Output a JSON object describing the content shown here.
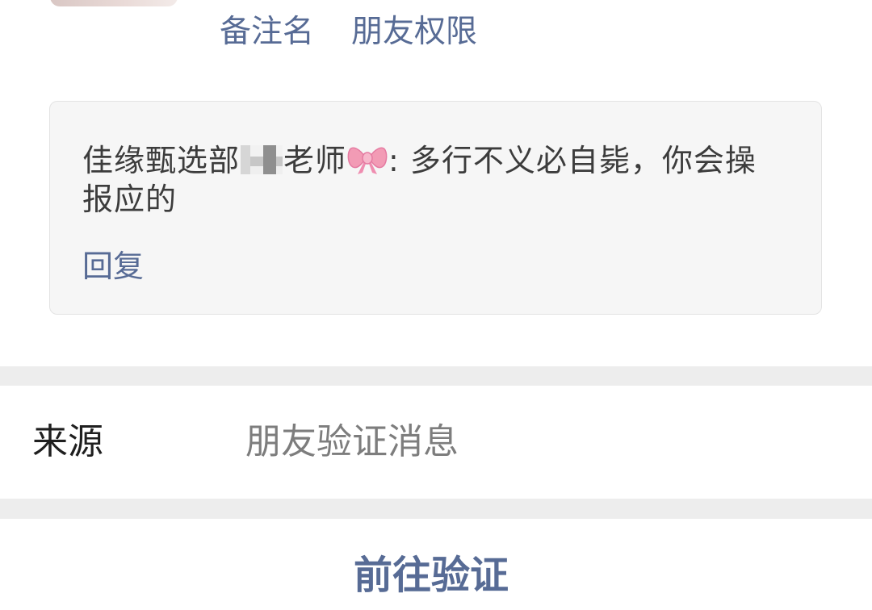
{
  "profile": {
    "links": [
      "备注名",
      "朋友权限"
    ]
  },
  "message": {
    "sender_prefix": "佳缘甄选部",
    "sender_suffix": "老师",
    "emoji": "bow-ribbon-icon",
    "separator": ": ",
    "content": "多行不义必自毙，你会操报应的",
    "reply_label": "回复"
  },
  "source": {
    "label": "来源",
    "value": "朋友验证消息"
  },
  "action": {
    "label": "前往验证"
  },
  "colors": {
    "link": "#576b95",
    "card_bg": "#f6f6f6",
    "separator_bg": "#ededed",
    "bow_pink": "#f29bb5"
  }
}
